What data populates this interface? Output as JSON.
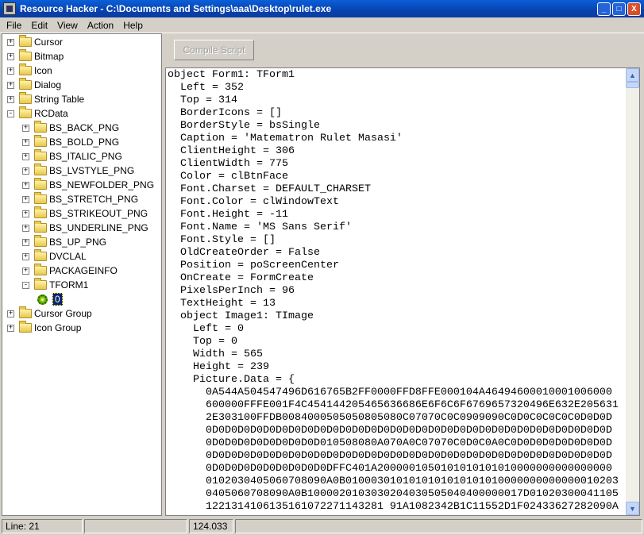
{
  "window": {
    "title": "Resource Hacker  -  C:\\Documents and Settings\\aaa\\Desktop\\rulet.exe",
    "minimize": "_",
    "maximize": "□",
    "close": "X"
  },
  "menu": [
    "File",
    "Edit",
    "View",
    "Action",
    "Help"
  ],
  "tree": [
    {
      "label": "Cursor",
      "level": 0,
      "state": "+"
    },
    {
      "label": "Bitmap",
      "level": 0,
      "state": "+"
    },
    {
      "label": "Icon",
      "level": 0,
      "state": "+"
    },
    {
      "label": "Dialog",
      "level": 0,
      "state": "+"
    },
    {
      "label": "String Table",
      "level": 0,
      "state": "+"
    },
    {
      "label": "RCData",
      "level": 0,
      "state": "-"
    },
    {
      "label": "BS_BACK_PNG",
      "level": 1,
      "state": "+"
    },
    {
      "label": "BS_BOLD_PNG",
      "level": 1,
      "state": "+"
    },
    {
      "label": "BS_ITALIC_PNG",
      "level": 1,
      "state": "+"
    },
    {
      "label": "BS_LVSTYLE_PNG",
      "level": 1,
      "state": "+"
    },
    {
      "label": "BS_NEWFOLDER_PNG",
      "level": 1,
      "state": "+"
    },
    {
      "label": "BS_STRETCH_PNG",
      "level": 1,
      "state": "+"
    },
    {
      "label": "BS_STRIKEOUT_PNG",
      "level": 1,
      "state": "+"
    },
    {
      "label": "BS_UNDERLINE_PNG",
      "level": 1,
      "state": "+"
    },
    {
      "label": "BS_UP_PNG",
      "level": 1,
      "state": "+"
    },
    {
      "label": "DVCLAL",
      "level": 1,
      "state": "+"
    },
    {
      "label": "PACKAGEINFO",
      "level": 1,
      "state": "+"
    },
    {
      "label": "TFORM1",
      "level": 1,
      "state": "-"
    },
    {
      "label": "0",
      "level": 2,
      "state": "leaf",
      "selected": true
    },
    {
      "label": "Cursor Group",
      "level": 0,
      "state": "+"
    },
    {
      "label": "Icon Group",
      "level": 0,
      "state": "+"
    }
  ],
  "toolbar": {
    "compile_label": "Compile Script"
  },
  "editor": {
    "lines": [
      "object Form1: TForm1",
      "  Left = 352",
      "  Top = 314",
      "  BorderIcons = []",
      "  BorderStyle = bsSingle",
      "  Caption = 'Matematron Rulet Masasi'",
      "  ClientHeight = 306",
      "  ClientWidth = 775",
      "  Color = clBtnFace",
      "  Font.Charset = DEFAULT_CHARSET",
      "  Font.Color = clWindowText",
      "  Font.Height = -11",
      "  Font.Name = 'MS Sans Serif'",
      "  Font.Style = []",
      "  OldCreateOrder = False",
      "  Position = poScreenCenter",
      "  OnCreate = FormCreate",
      "  PixelsPerInch = 96",
      "  TextHeight = 13",
      "  object Image1: TImage",
      "    Left = 0",
      "    Top = 0",
      "    Width = 565",
      "    Height = 239",
      "    Picture.Data = {",
      "      0A544A504547496D616765B2FF0000FFD8FFE000104A46494600010001006000",
      "      600000FFFE001F4C454144205465636686E6F6C6F6769657320496E632E205631",
      "      2E303100FFDB0084000505050805080C07070C0C0909090C0D0C0C0C0C0D0D0D",
      "      0D0D0D0D0D0D0D0D0D0D0D0D0D0D0D0D0D0D0D0D0D0D0D0D0D0D0D0D0D0D0D0D",
      "      0D0D0D0D0D0D0D0D0D010508080A070A0C07070C0D0C0A0C0D0D0D0D0D0D0D0D",
      "      0D0D0D0D0D0D0D0D0D0D0D0D0D0D0D0D0D0D0D0D0D0D0D0D0D0D0D0D0D0D0D0D",
      "      0D0D0D0D0D0D0D0D0D0DFFC401A2000001050101010101010000000000000000",
      "      0102030405060708090A0B0100030101010101010101010000000000000010203",
      "      0405060708090A0B1000020103030204030505040400000017D01020300041105",
      "      1221314106135161072271143281 91A1082342B1C11552D1F02433627282090A"
    ]
  },
  "status": {
    "line": "Line: 21",
    "position": "124.033"
  }
}
